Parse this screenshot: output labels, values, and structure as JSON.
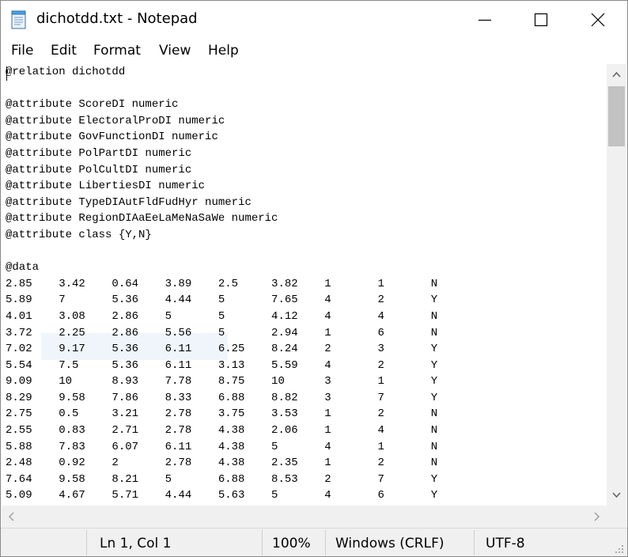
{
  "window": {
    "title": "dichotdd.txt - Notepad",
    "icon": "notepad-icon",
    "controls": [
      "minimize-icon",
      "maximize-icon",
      "close-icon"
    ]
  },
  "menu": {
    "file": "File",
    "edit": "Edit",
    "format": "Format",
    "view": "View",
    "help": "Help"
  },
  "document": {
    "text": "@relation dichotdd\n\n@attribute ScoreDI numeric\n@attribute ElectoralProDI numeric\n@attribute GovFunctionDI numeric\n@attribute PolPartDI numeric\n@attribute PolCultDI numeric\n@attribute LibertiesDI numeric\n@attribute TypeDIAutFldFudHyr numeric\n@attribute RegionDIAaEeLaMeNaSaWe numeric\n@attribute class {Y,N}\n\n@data\n2.85    3.42    0.64    3.89    2.5     3.82    1       1       N\n5.89    7       5.36    4.44    5       7.65    4       2       Y\n4.01    3.08    2.86    5       5       4.12    4       4       N\n3.72    2.25    2.86    5.56    5       2.94    1       6       N\n7.02    9.17    5.36    6.11    6.25    8.24    2       3       Y\n5.54    7.5     5.36    6.11    3.13    5.59    4       2       Y\n9.09    10      8.93    7.78    8.75    10      3       1       Y\n8.29    9.58    7.86    8.33    6.88    8.82    3       7       Y\n2.75    0.5     3.21    2.78    3.75    3.53    1       2       N\n2.55    0.83    2.71    2.78    4.38    2.06    1       4       N\n5.88    7.83    6.07    6.11    4.38    5       4       1       N\n2.48    0.92    2       2.78    4.38    2.35    1       2       N\n7.64    9.58    8.21    5       6.88    8.53    2       7       Y\n5.09    4.67    5.71    4.44    5.63    5       4       6       Y"
  },
  "status": {
    "position": "Ln 1, Col 1",
    "zoom": "100%",
    "line_ending": "Windows (CRLF)",
    "encoding": "UTF-8"
  }
}
